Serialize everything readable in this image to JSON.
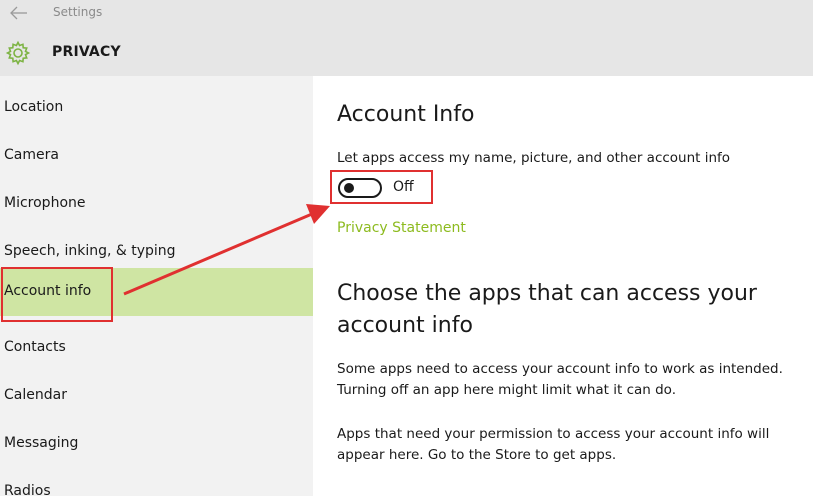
{
  "window": {
    "title": "Settings"
  },
  "header": {
    "section": "PRIVACY"
  },
  "sidebar": {
    "items": [
      {
        "label": "Location"
      },
      {
        "label": "Camera"
      },
      {
        "label": "Microphone"
      },
      {
        "label": "Speech, inking, & typing"
      },
      {
        "label": "Account info"
      },
      {
        "label": "Contacts"
      },
      {
        "label": "Calendar"
      },
      {
        "label": "Messaging"
      },
      {
        "label": "Radios"
      }
    ],
    "selected": "Account info"
  },
  "content": {
    "title": "Account Info",
    "description": "Let apps access my name, picture, and other account info",
    "toggle": {
      "state_label": "Off",
      "on": false
    },
    "privacy_link": "Privacy Statement",
    "apps_heading": "Choose the apps that can access your account info",
    "para1": "Some apps need to access your account info to work as intended. Turning off an app here might limit what it can do.",
    "para2": "Apps that need your permission to access your account info will appear here. Go to the Store to get apps."
  },
  "colors": {
    "accent": "#8dbb1f",
    "selection": "#cfe5a3",
    "annotation": "#e03030"
  },
  "icons": {
    "back": "back-arrow-icon",
    "settings": "gear-icon"
  }
}
